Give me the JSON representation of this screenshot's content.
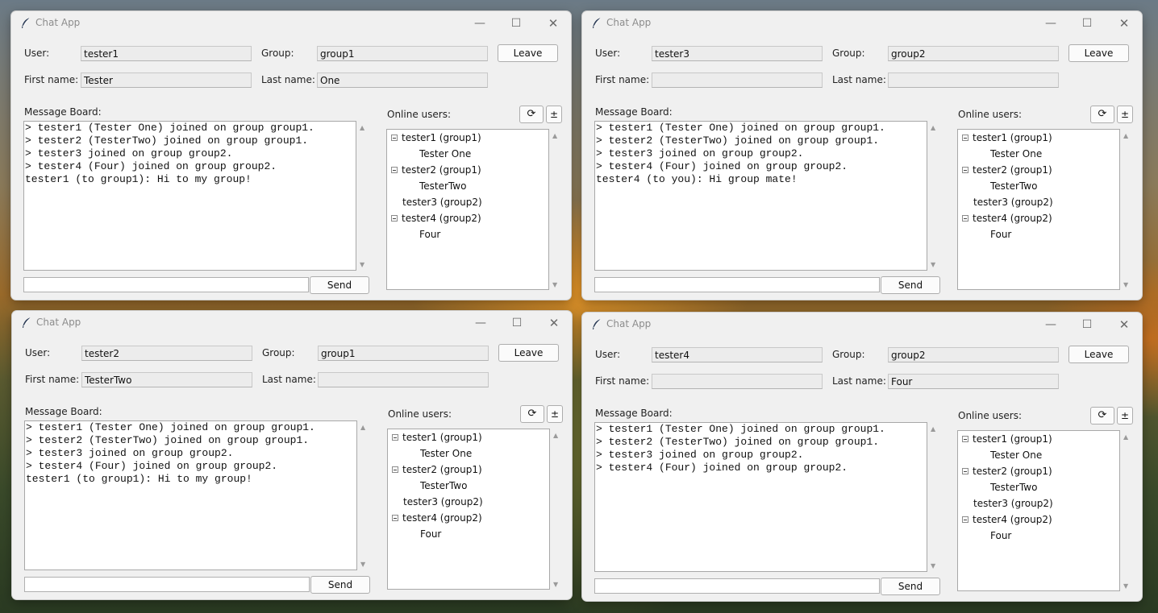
{
  "labels": {
    "user": "User:",
    "group": "Group:",
    "first_name": "First name:",
    "last_name": "Last name:",
    "message_board": "Message Board:",
    "online_users": "Online users:",
    "leave": "Leave",
    "send": "Send",
    "refresh_glyph": "⟳",
    "plusminus_glyph": "±"
  },
  "windows": [
    {
      "title": "Chat App",
      "user": "tester1",
      "group": "group1",
      "first_name": "Tester",
      "last_name": "One",
      "board": [
        "> tester1 (Tester One) joined on group group1.",
        "> tester2 (TesterTwo) joined on group group1.",
        "> tester3 joined on group group2.",
        "> tester4 (Four) joined on group group2.",
        "tester1 (to group1): Hi to my group!"
      ],
      "message_input": "",
      "online_users": [
        {
          "label": "tester1 (group1)",
          "child": "Tester One"
        },
        {
          "label": "tester2 (group1)",
          "child": "TesterTwo"
        },
        {
          "label": "tester3 (group2)",
          "child": ""
        },
        {
          "label": "tester4 (group2)",
          "child": "Four"
        }
      ]
    },
    {
      "title": "Chat App",
      "user": "tester3",
      "group": "group2",
      "first_name": "",
      "last_name": "",
      "board": [
        "> tester1 (Tester One) joined on group group1.",
        "> tester2 (TesterTwo) joined on group group1.",
        "> tester3 joined on group group2.",
        "> tester4 (Four) joined on group group2.",
        "tester4 (to you): Hi group mate!"
      ],
      "message_input": "",
      "online_users": [
        {
          "label": "tester1 (group1)",
          "child": "Tester One"
        },
        {
          "label": "tester2 (group1)",
          "child": "TesterTwo"
        },
        {
          "label": "tester3 (group2)",
          "child": ""
        },
        {
          "label": "tester4 (group2)",
          "child": "Four"
        }
      ]
    },
    {
      "title": "Chat App",
      "user": "tester2",
      "group": "group1",
      "first_name": "TesterTwo",
      "last_name": "",
      "board": [
        "> tester1 (Tester One) joined on group group1.",
        "> tester2 (TesterTwo) joined on group group1.",
        "> tester3 joined on group group2.",
        "> tester4 (Four) joined on group group2.",
        "tester1 (to group1): Hi to my group!"
      ],
      "message_input": "",
      "online_users": [
        {
          "label": "tester1 (group1)",
          "child": "Tester One"
        },
        {
          "label": "tester2 (group1)",
          "child": "TesterTwo"
        },
        {
          "label": "tester3 (group2)",
          "child": ""
        },
        {
          "label": "tester4 (group2)",
          "child": "Four"
        }
      ]
    },
    {
      "title": "Chat App",
      "user": "tester4",
      "group": "group2",
      "first_name": "",
      "last_name": "Four",
      "board": [
        "> tester1 (Tester One) joined on group group1.",
        "> tester2 (TesterTwo) joined on group group1.",
        "> tester3 joined on group group2.",
        "> tester4 (Four) joined on group group2."
      ],
      "message_input": "",
      "online_users": [
        {
          "label": "tester1 (group1)",
          "child": "Tester One"
        },
        {
          "label": "tester2 (group1)",
          "child": "TesterTwo"
        },
        {
          "label": "tester3 (group2)",
          "child": ""
        },
        {
          "label": "tester4 (group2)",
          "child": "Four"
        }
      ]
    }
  ]
}
